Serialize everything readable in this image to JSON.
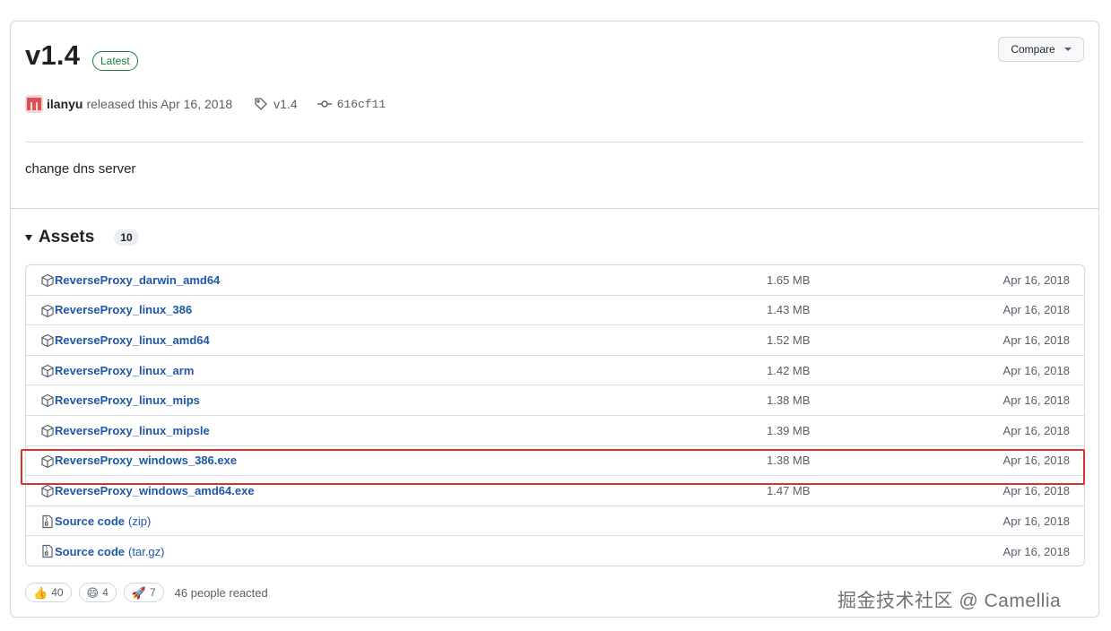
{
  "release": {
    "title": "v1.4",
    "badge": "Latest",
    "compare_label": "Compare",
    "author": "ilanyu",
    "released_text": "released this Apr 16, 2018",
    "tag": "v1.4",
    "commit": "616cf11",
    "body": "change dns server"
  },
  "assets": {
    "heading": "Assets",
    "count": "10",
    "items": [
      {
        "name": "ReverseProxy_darwin_amd64",
        "size": "1.65 MB",
        "date": "Apr 16, 2018",
        "icon": "package-icon"
      },
      {
        "name": "ReverseProxy_linux_386",
        "size": "1.43 MB",
        "date": "Apr 16, 2018",
        "icon": "package-icon"
      },
      {
        "name": "ReverseProxy_linux_amd64",
        "size": "1.52 MB",
        "date": "Apr 16, 2018",
        "icon": "package-icon"
      },
      {
        "name": "ReverseProxy_linux_arm",
        "size": "1.42 MB",
        "date": "Apr 16, 2018",
        "icon": "package-icon"
      },
      {
        "name": "ReverseProxy_linux_mips",
        "size": "1.38 MB",
        "date": "Apr 16, 2018",
        "icon": "package-icon"
      },
      {
        "name": "ReverseProxy_linux_mipsle",
        "size": "1.39 MB",
        "date": "Apr 16, 2018",
        "icon": "package-icon"
      },
      {
        "name": "ReverseProxy_windows_386.exe",
        "size": "1.38 MB",
        "date": "Apr 16, 2018",
        "icon": "package-icon"
      },
      {
        "name": "ReverseProxy_windows_amd64.exe",
        "size": "1.47 MB",
        "date": "Apr 16, 2018",
        "icon": "package-icon"
      },
      {
        "name": "Source code",
        "suffix": "(zip)",
        "size": "",
        "date": "Apr 16, 2018",
        "icon": "file-zip-icon"
      },
      {
        "name": "Source code",
        "suffix": "(tar.gz)",
        "size": "",
        "date": "Apr 16, 2018",
        "icon": "file-zip-icon"
      }
    ]
  },
  "reactions": {
    "items": [
      {
        "emoji": "👍",
        "count": "40",
        "icon": "thumbs-up-icon"
      },
      {
        "emoji": "😄",
        "count": "4",
        "icon": "laugh-icon"
      },
      {
        "emoji": "🚀",
        "count": "7",
        "icon": "rocket-icon"
      }
    ],
    "summary": "46 people reacted"
  },
  "watermark": "掘金技术社区 @ Camellia",
  "colors": {
    "link": "#1f57a8",
    "latest_badge": "#1a7f37",
    "highlight": "#d9332b",
    "border": "#d0d7de"
  }
}
